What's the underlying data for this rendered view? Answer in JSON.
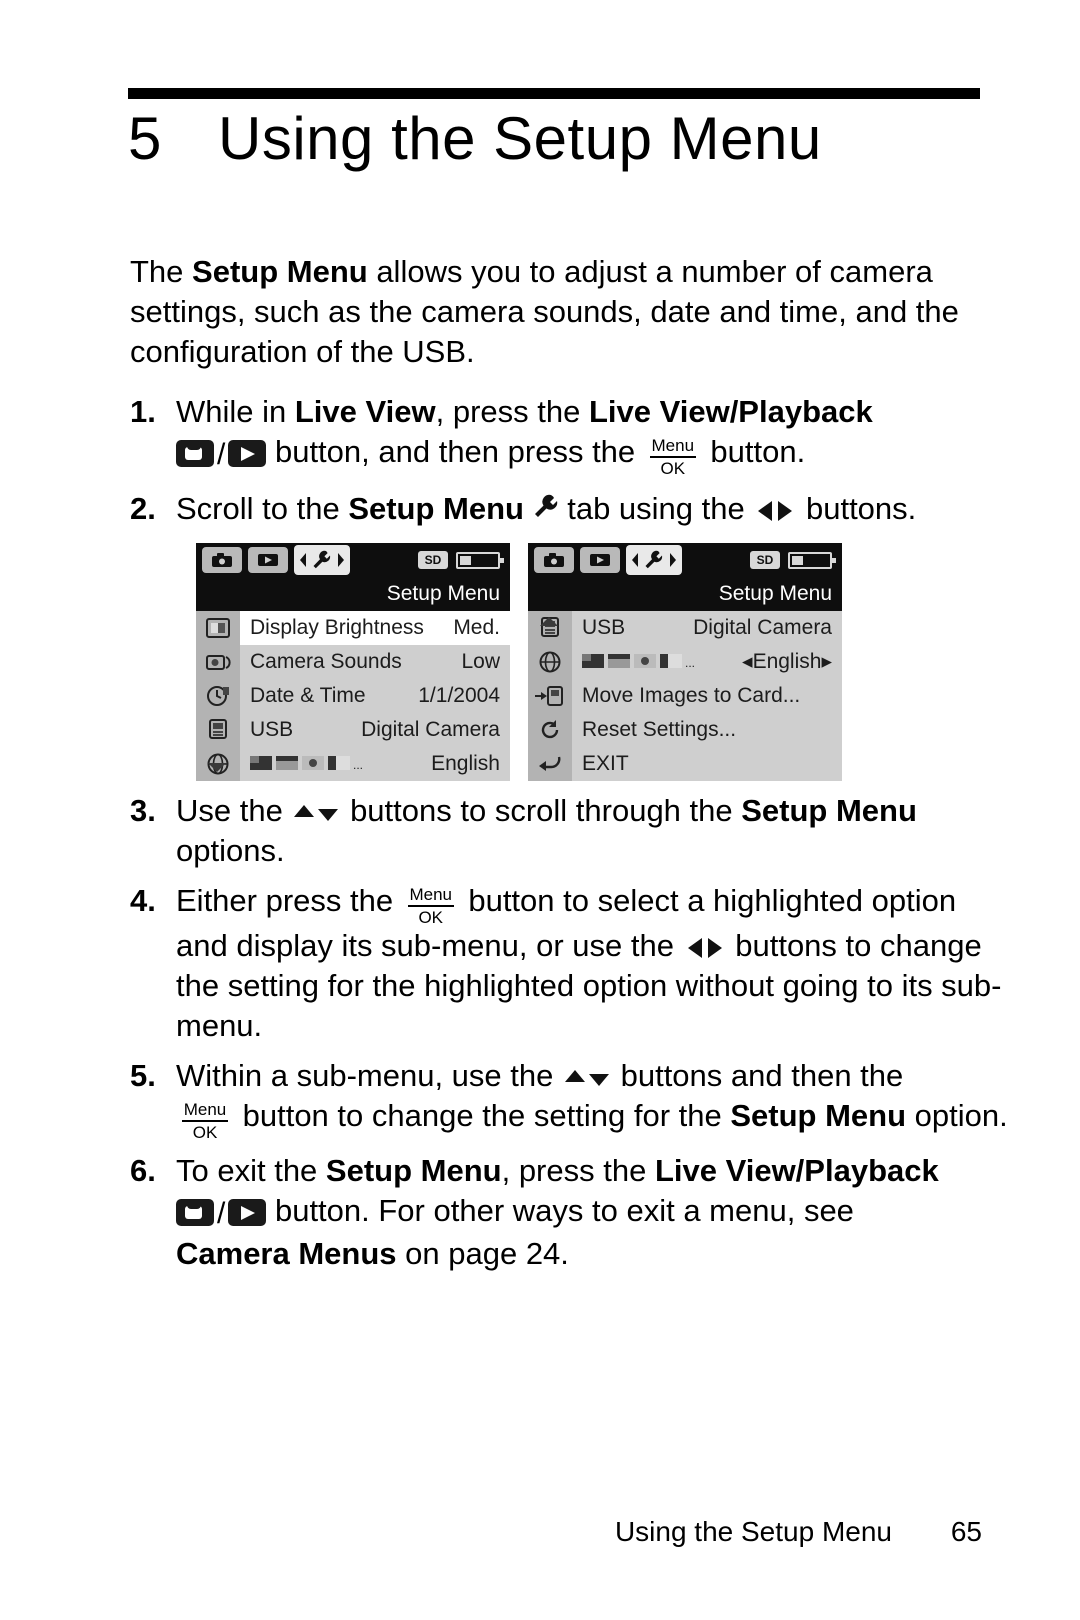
{
  "chapter": {
    "number": "5",
    "title": "Using the Setup Menu"
  },
  "intro": {
    "t1": "The ",
    "b1": "Setup Menu",
    "t2": " allows you to adjust a number of camera settings, such as the camera sounds, date and time, and the configuration of the USB."
  },
  "steps": [
    {
      "num": "1.",
      "p1": "While in ",
      "b1": "Live View",
      "p2": ", press the ",
      "b2": "Live View/Playback",
      "p3": " button, and then press the ",
      "p4": " button."
    },
    {
      "num": "2.",
      "p1": "Scroll to the ",
      "b1": "Setup Menu",
      "p2": " tab using the ",
      "p3": " buttons."
    },
    {
      "num": "3.",
      "p1": "Use the ",
      "p2": " buttons to scroll through the ",
      "b1": "Setup Menu",
      "p3": " options."
    },
    {
      "num": "4.",
      "p1": "Either press the ",
      "p2": " button to select a highlighted option and display its sub-menu, or use the ",
      "p3": " buttons to change the setting for the highlighted option without going to its sub-menu."
    },
    {
      "num": "5.",
      "p1": "Within a sub-menu, use the ",
      "p2": " buttons and then the ",
      "p3": " button to change the setting for the ",
      "b1": "Setup Menu",
      "p4": " option."
    },
    {
      "num": "6.",
      "p1": "To exit the ",
      "b1": "Setup Menu",
      "p2": ", press the ",
      "b2": "Live View/Playback",
      "p3": " button. For other ways to exit a menu, see ",
      "b3": "Camera Menus",
      "p4": " on page 24."
    }
  ],
  "menu_button": {
    "top": "Menu",
    "bottom": "OK"
  },
  "screens": [
    {
      "name": "setup-menu-screen-page1",
      "title": "Setup Menu",
      "sd_label": "SD",
      "scroll_down": true,
      "scroll_up": false,
      "rows": [
        {
          "label": "Display Brightness",
          "value": "Med.",
          "highlighted": true,
          "icon": "brightness-icon"
        },
        {
          "label": "Camera Sounds",
          "value": "Low",
          "highlighted": false,
          "icon": "speaker-camera-icon"
        },
        {
          "label": "Date & Time",
          "value": "1/1/2004",
          "highlighted": false,
          "icon": "clock-icon"
        },
        {
          "label": "USB",
          "value": "Digital Camera",
          "highlighted": false,
          "icon": "usb-icon"
        },
        {
          "label": "",
          "value": "English",
          "highlighted": false,
          "icon": "globe-icon",
          "flags": true
        }
      ]
    },
    {
      "name": "setup-menu-screen-page2",
      "title": "Setup Menu",
      "sd_label": "SD",
      "scroll_down": false,
      "scroll_up": true,
      "rows": [
        {
          "label": "USB",
          "value": "Digital Camera",
          "highlighted": false,
          "icon": "usb-icon"
        },
        {
          "label": "",
          "value": "English",
          "highlighted": false,
          "icon": "globe-icon",
          "flags": true,
          "value_arrows": true
        },
        {
          "label": "Move Images to Card...",
          "value": "",
          "highlighted": false,
          "icon": "move-images-icon"
        },
        {
          "label": "Reset Settings...",
          "value": "",
          "highlighted": false,
          "icon": "reset-icon"
        },
        {
          "label": "EXIT",
          "value": "",
          "highlighted": false,
          "icon": "exit-icon"
        }
      ]
    }
  ],
  "footer": {
    "text": "Using the Setup Menu",
    "page": "65"
  }
}
